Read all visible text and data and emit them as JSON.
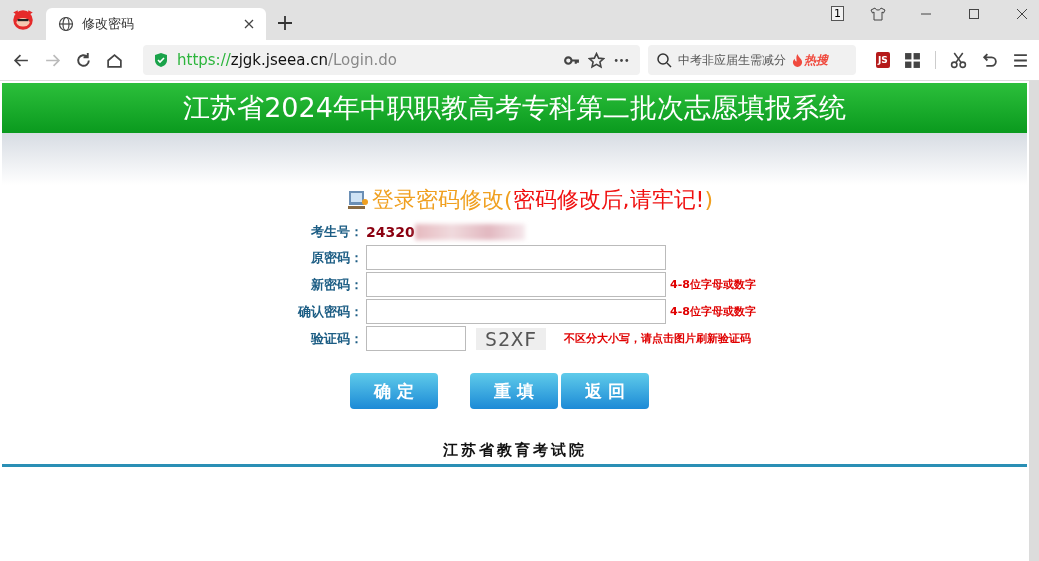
{
  "browser": {
    "tab": {
      "title": "修改密码",
      "selected": true
    },
    "url": {
      "scheme": "https://",
      "host": "zjgk.jseea.cn",
      "path": "/Login.do"
    },
    "tab_counter": "1",
    "search": {
      "value": "中考非应届生需减分",
      "hot_label": "热搜"
    },
    "ext_label": "JS"
  },
  "header": {
    "title": "江苏省2024年中职职教高考专科第二批次志愿填报系统"
  },
  "form": {
    "title": "登录密码修改",
    "title_note_open": "(",
    "title_note": "密码修改后,请牢记!",
    "title_note_close": ")",
    "id_label": "考生号：",
    "id_value": "24320",
    "fields": [
      {
        "kind": "text",
        "label": "原密码："
      },
      {
        "kind": "text",
        "label": "新密码：",
        "hint": "4-8位字母或数字"
      },
      {
        "kind": "text",
        "label": "确认密码：",
        "hint": "4-8位字母或数字"
      },
      {
        "kind": "captcha",
        "label": "验证码：",
        "captcha": "S2XF",
        "hint": "不区分大小写，请点击图片刷新验证码"
      }
    ],
    "buttons": [
      "确 定",
      "重 填",
      "返 回"
    ]
  },
  "footer": "江苏省教育考试院"
}
